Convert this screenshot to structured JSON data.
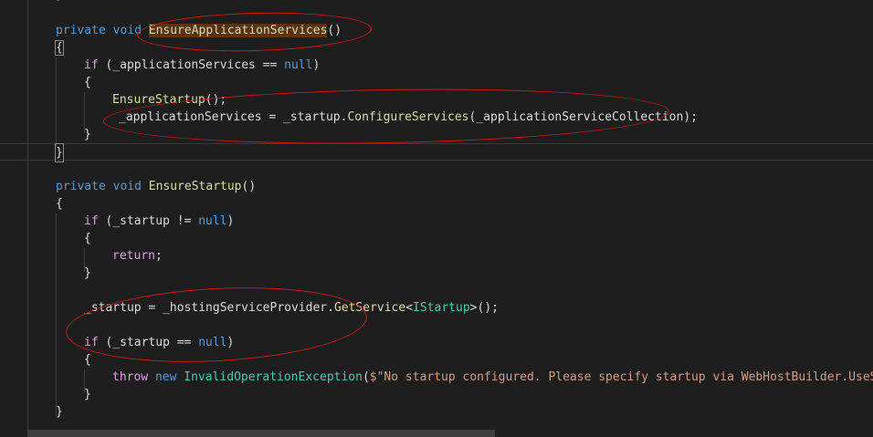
{
  "editor": {
    "lines": {
      "top_brace": "}",
      "l1_kw": "private void ",
      "l1_method": "EnsureApplicationServices",
      "l1_parens": "()",
      "l2": "{",
      "l3_if": "if",
      "l3_text": " (_applicationServices == ",
      "l3_null": "null",
      "l3_close": ")",
      "l4": "{",
      "l5_call": "EnsureStartup",
      "l5_rest": "();",
      "l6_a": "_applicationServices = _startup.",
      "l6_method": "ConfigureServices",
      "l6_b": "(_applicationServiceCollection);",
      "l7": "}",
      "l8": "}",
      "l9_kw": "private void ",
      "l9_method": "EnsureStartup",
      "l9_parens": "()",
      "l10": "{",
      "l11_if": "if",
      "l11_text": " (_startup != ",
      "l11_null": "null",
      "l11_close": ")",
      "l12": "{",
      "l13_return": "return",
      "l13_semi": ";",
      "l14": "}",
      "l15_a": "_startup = _hostingServiceProvider.",
      "l15_method": "GetService",
      "l15_lt": "<",
      "l15_type": "IStartup",
      "l15_b": ">();",
      "l16_if": "if",
      "l16_text": " (_startup == ",
      "l16_null": "null",
      "l16_close": ")",
      "l17": "{",
      "l18_throw": "throw",
      "l18_new": "new",
      "l18_type": "InvalidOperationException",
      "l18_paren": "(",
      "l18_str": "$\"No startup configured. Please specify startup via WebHostBuilder.UseSta",
      "l19": "}",
      "l20": "}"
    }
  },
  "colors": {
    "background": "#1e1e1e",
    "keyword": "#569cd6",
    "control": "#d8a0df",
    "method": "#dcdcaa",
    "type": "#4ec9b0",
    "string": "#d69d85",
    "annotation": "#d11818"
  }
}
